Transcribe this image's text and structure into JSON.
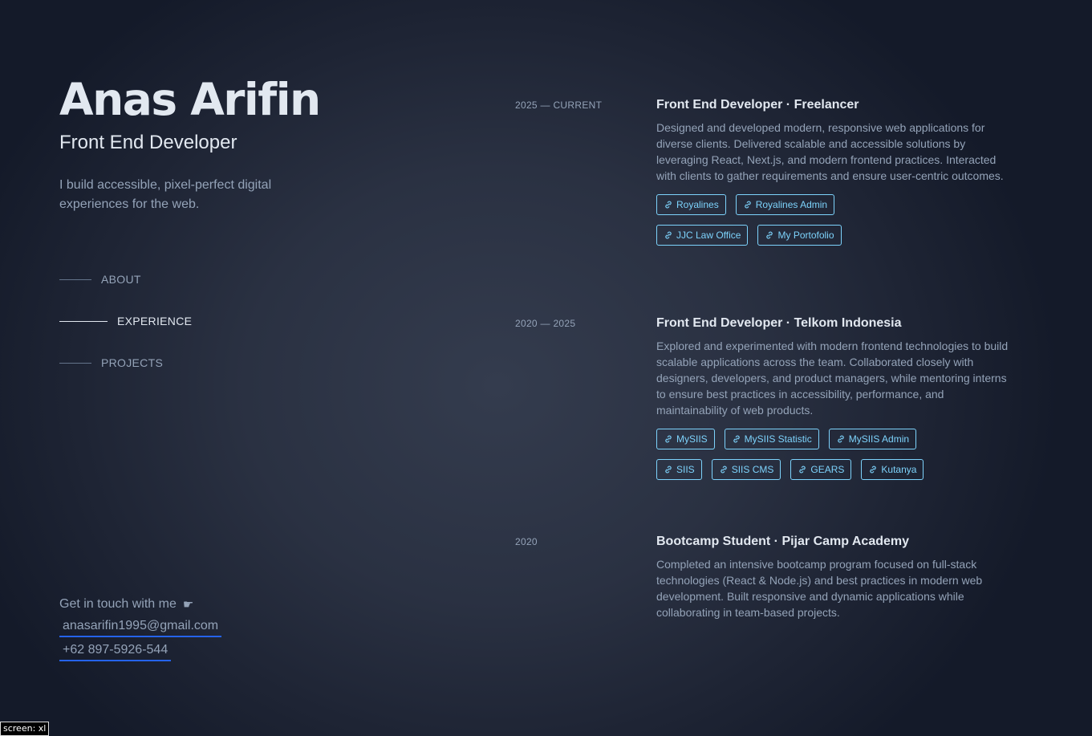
{
  "profile": {
    "name": "Anas Arifin",
    "role": "Front End Developer",
    "tagline": "I build accessible, pixel-perfect digital experiences for the web."
  },
  "nav": {
    "items": [
      {
        "label": "ABOUT",
        "active": false
      },
      {
        "label": "EXPERIENCE",
        "active": true
      },
      {
        "label": "PROJECTS",
        "active": false
      }
    ]
  },
  "contact": {
    "title": "Get in touch with me",
    "icon": "hand-pointing-right-icon",
    "email": "anasarifin1995@gmail.com",
    "phone": "+62 897-5926-544"
  },
  "experience": [
    {
      "date": "2025 — CURRENT",
      "title": "Front End Developer · Freelancer",
      "description": "Designed and developed modern, responsive web applications for diverse clients. Delivered scalable and accessible solutions by leveraging React, Next.js, and modern frontend practices. Interacted with clients to gather requirements and ensure user-centric outcomes.",
      "links": [
        "Royalines",
        "Royalines Admin",
        "JJC Law Office",
        "My Portofolio"
      ]
    },
    {
      "date": "2020 — 2025",
      "title": "Front End Developer · Telkom Indonesia",
      "description": "Explored and experimented with modern frontend technologies to build scalable applications across the team. Collaborated closely with designers, developers, and product managers, while mentoring interns to ensure best practices in accessibility, performance, and maintainability of web products.",
      "links": [
        "MySIIS",
        "MySIIS Statistic",
        "MySIIS Admin",
        "SIIS",
        "SIIS CMS",
        "GEARS",
        "Kutanya"
      ]
    },
    {
      "date": "2020",
      "title": "Bootcamp Student · Pijar Camp Academy",
      "description": "Completed an intensive bootcamp program focused on full-stack technologies (React & Node.js) and best practices in modern web development. Built responsive and dynamic applications while collaborating in team-based projects.",
      "links": []
    }
  ],
  "debug": {
    "screen_label": "screen: xl"
  },
  "colors": {
    "accent_tag": "#7dd3fc",
    "underline": "#2563eb",
    "heading": "#e2e8f0",
    "muted": "#94a3b8"
  }
}
